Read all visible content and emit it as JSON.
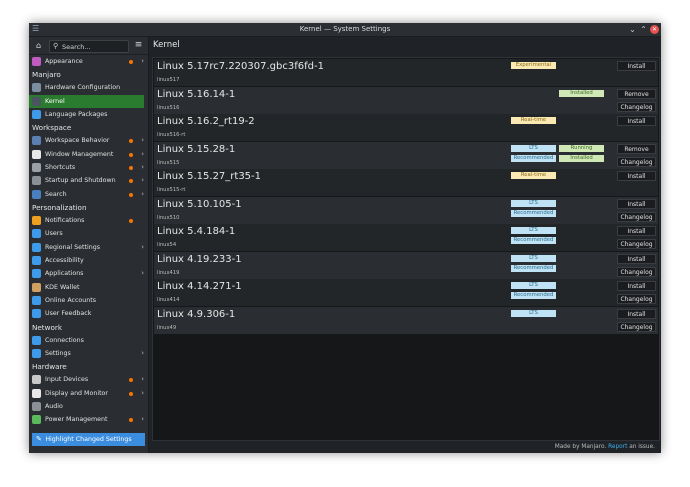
{
  "window": {
    "title": "Kernel — System Settings"
  },
  "sidebar": {
    "search_placeholder": "Search...",
    "highlight_button": "Highlight Changed Settings",
    "entries": [
      {
        "type": "item",
        "label": "Appearance",
        "icon": "appearance-icon",
        "color": "#c05cc0",
        "dot": true,
        "chevron": true
      },
      {
        "type": "header",
        "label": "Manjaro"
      },
      {
        "type": "item",
        "label": "Hardware Configuration",
        "icon": "hardware-config-icon",
        "color": "#7b8ea0",
        "dot": false,
        "chevron": false
      },
      {
        "type": "item",
        "label": "Kernel",
        "icon": "kernel-icon",
        "color": "#4a5560",
        "dot": false,
        "chevron": false,
        "active": true
      },
      {
        "type": "item",
        "label": "Language Packages",
        "icon": "language-packages-icon",
        "color": "#3d9be9",
        "dot": false,
        "chevron": false
      },
      {
        "type": "header",
        "label": "Workspace"
      },
      {
        "type": "item",
        "label": "Workspace Behavior",
        "icon": "workspace-behavior-icon",
        "color": "#5a7fb0",
        "dot": true,
        "chevron": true
      },
      {
        "type": "item",
        "label": "Window Management",
        "icon": "window-management-icon",
        "color": "#e8e8e8",
        "dot": true,
        "chevron": true
      },
      {
        "type": "item",
        "label": "Shortcuts",
        "icon": "shortcuts-icon",
        "color": "#9aa0a6",
        "dot": true,
        "chevron": true
      },
      {
        "type": "item",
        "label": "Startup and Shutdown",
        "icon": "startup-shutdown-icon",
        "color": "#8a9096",
        "dot": true,
        "chevron": true
      },
      {
        "type": "item",
        "label": "Search",
        "icon": "search-icon",
        "color": "#4a7fc0",
        "dot": true,
        "chevron": true
      },
      {
        "type": "header",
        "label": "Personalization"
      },
      {
        "type": "item",
        "label": "Notifications",
        "icon": "notifications-icon",
        "color": "#f0a020",
        "dot": true,
        "chevron": false
      },
      {
        "type": "item",
        "label": "Users",
        "icon": "users-icon",
        "color": "#3d9be9",
        "dot": false,
        "chevron": false
      },
      {
        "type": "item",
        "label": "Regional Settings",
        "icon": "regional-settings-icon",
        "color": "#3d9be9",
        "dot": false,
        "chevron": true
      },
      {
        "type": "item",
        "label": "Accessibility",
        "icon": "accessibility-icon",
        "color": "#3d9be9",
        "dot": false,
        "chevron": false
      },
      {
        "type": "item",
        "label": "Applications",
        "icon": "applications-icon",
        "color": "#3d9be9",
        "dot": false,
        "chevron": true
      },
      {
        "type": "item",
        "label": "KDE Wallet",
        "icon": "kde-wallet-icon",
        "color": "#d0a060",
        "dot": false,
        "chevron": false
      },
      {
        "type": "item",
        "label": "Online Accounts",
        "icon": "online-accounts-icon",
        "color": "#3d9be9",
        "dot": false,
        "chevron": false
      },
      {
        "type": "item",
        "label": "User Feedback",
        "icon": "user-feedback-icon",
        "color": "#3d9be9",
        "dot": false,
        "chevron": false
      },
      {
        "type": "header",
        "label": "Network"
      },
      {
        "type": "item",
        "label": "Connections",
        "icon": "connections-icon",
        "color": "#3d9be9",
        "dot": false,
        "chevron": false
      },
      {
        "type": "item",
        "label": "Settings",
        "icon": "network-settings-icon",
        "color": "#3d9be9",
        "dot": false,
        "chevron": true
      },
      {
        "type": "header",
        "label": "Hardware"
      },
      {
        "type": "item",
        "label": "Input Devices",
        "icon": "input-devices-icon",
        "color": "#c8c8c8",
        "dot": true,
        "chevron": true
      },
      {
        "type": "item",
        "label": "Display and Monitor",
        "icon": "display-monitor-icon",
        "color": "#e8e8e8",
        "dot": true,
        "chevron": true
      },
      {
        "type": "item",
        "label": "Audio",
        "icon": "audio-icon",
        "color": "#8a9096",
        "dot": false,
        "chevron": false
      },
      {
        "type": "item",
        "label": "Power Management",
        "icon": "power-management-icon",
        "color": "#5cb85c",
        "dot": true,
        "chevron": true
      }
    ]
  },
  "main": {
    "title": "Kernel",
    "kernels": [
      {
        "name": "Linux 5.17rc7.220307.gbc3f6fd-1",
        "pkg": "linux517",
        "col1": [
          "Experimental"
        ],
        "col2": [],
        "actions": [
          "Install"
        ]
      },
      {
        "name": "Linux 5.16.14-1",
        "pkg": "linux516",
        "col1": [],
        "col2": [
          "Installed"
        ],
        "actions": [
          "Remove",
          "Changelog"
        ]
      },
      {
        "name": "Linux 5.16.2_rt19-2",
        "pkg": "linux516-rt",
        "col1": [
          "Real-time"
        ],
        "col2": [],
        "actions": [
          "Install"
        ]
      },
      {
        "name": "Linux 5.15.28-1",
        "pkg": "linux515",
        "col1": [
          "LTS",
          "Recommended"
        ],
        "col2": [
          "Running",
          "Installed"
        ],
        "actions": [
          "Remove",
          "Changelog"
        ]
      },
      {
        "name": "Linux 5.15.27_rt35-1",
        "pkg": "linux515-rt",
        "col1": [
          "Real-time"
        ],
        "col2": [],
        "actions": [
          "Install"
        ]
      },
      {
        "name": "Linux 5.10.105-1",
        "pkg": "linux510",
        "col1": [
          "LTS",
          "Recommended"
        ],
        "col2": [],
        "actions": [
          "Install",
          "Changelog"
        ]
      },
      {
        "name": "Linux 5.4.184-1",
        "pkg": "linux54",
        "col1": [
          "LTS",
          "Recommended"
        ],
        "col2": [],
        "actions": [
          "Install",
          "Changelog"
        ]
      },
      {
        "name": "Linux 4.19.233-1",
        "pkg": "linux419",
        "col1": [
          "LTS",
          "Recommended"
        ],
        "col2": [],
        "actions": [
          "Install",
          "Changelog"
        ]
      },
      {
        "name": "Linux 4.14.271-1",
        "pkg": "linux414",
        "col1": [
          "LTS",
          "Recommended"
        ],
        "col2": [],
        "actions": [
          "Install",
          "Changelog"
        ]
      },
      {
        "name": "Linux 4.9.306-1",
        "pkg": "linux49",
        "col1": [
          "LTS"
        ],
        "col2": [],
        "actions": [
          "Install",
          "Changelog"
        ]
      }
    ],
    "footer": {
      "text": "Made by Manjaro.",
      "link": "Report",
      "suffix": "an issue."
    }
  }
}
